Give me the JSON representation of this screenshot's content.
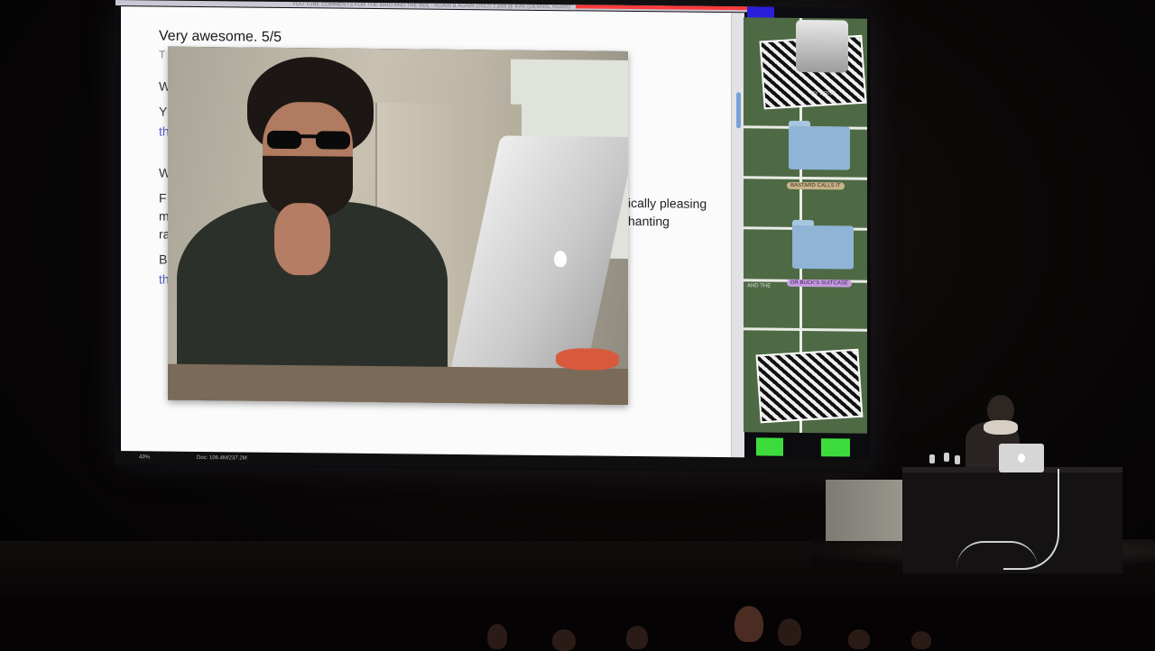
{
  "screen": {
    "window_title": "YOU TUBE COMMENTS FOR THE BIRD AND THE BEE - AGAIN & AGAIN (2012) 2.psd @ 43% (DENNIS, RGB/8)",
    "document": {
      "heading": "Very awesome. 5/5",
      "left_fragments": [
        "T",
        "W",
        "Y",
        "th",
        "W",
        "F",
        "m",
        "ra",
        "B",
        "th"
      ],
      "right_fragments": [
        "ically pleasing",
        "hanting"
      ]
    },
    "status_bar": {
      "zoom": "43%",
      "doc_size": "Doc: 106.4M/237.2M"
    },
    "finder": {
      "labels": [
        "MY DRIVE",
        "BASTARD CALLS IT",
        "DR BUCK'S SUITCASE",
        "AND THE"
      ]
    }
  },
  "colors": {
    "background": "#050404",
    "screen_green": "#4e6a44",
    "status_green": "#3ddc3d",
    "title_accent": "#ff3b3b",
    "link": "#5560c8"
  },
  "icons": [
    "hard-drive-icon",
    "folder-icon",
    "apple-logo-icon"
  ]
}
